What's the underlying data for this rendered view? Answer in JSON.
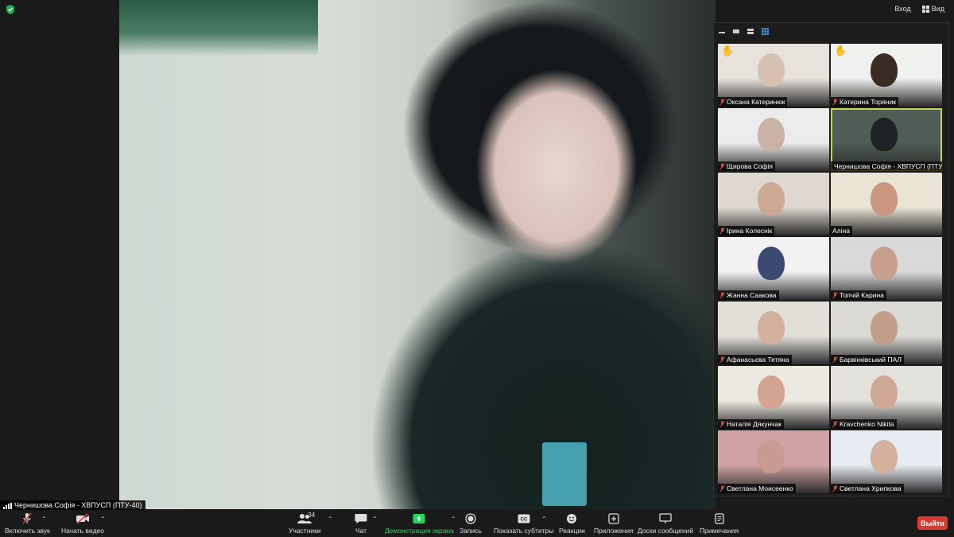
{
  "header": {
    "signin_label": "Вход",
    "view_label": "Вид"
  },
  "speaker": {
    "name": "Чернишова Софія - ХВПУСП (ПТУ-40)"
  },
  "gallery": {
    "participants": [
      {
        "name": "Оксана Катеринюк",
        "muted": true,
        "hand_raised": true,
        "active": false
      },
      {
        "name": "Катерина Торяник",
        "muted": true,
        "hand_raised": true,
        "active": false
      },
      {
        "name": "Щирова Софія",
        "muted": true,
        "hand_raised": false,
        "active": false
      },
      {
        "name": "Чернишова Софія - ХВПУСП (ПТУ-...",
        "muted": true,
        "hand_raised": false,
        "active": true
      },
      {
        "name": "Ірина Колеснік",
        "muted": true,
        "hand_raised": false,
        "active": false
      },
      {
        "name": "Аліна",
        "muted": false,
        "hand_raised": false,
        "active": false
      },
      {
        "name": "Жанна Саакова",
        "muted": true,
        "hand_raised": false,
        "active": false
      },
      {
        "name": "Топчій Карина",
        "muted": true,
        "hand_raised": false,
        "active": false
      },
      {
        "name": "Афанасьєва Тетяна",
        "muted": true,
        "hand_raised": false,
        "active": false
      },
      {
        "name": "Барвінківський ПАЛ",
        "muted": true,
        "hand_raised": false,
        "active": false
      },
      {
        "name": "Наталія Дякунчак",
        "muted": true,
        "hand_raised": false,
        "active": false
      },
      {
        "name": "Kravchenko Nikita",
        "muted": true,
        "hand_raised": false,
        "active": false
      },
      {
        "name": "Светлана Моисеенко",
        "muted": true,
        "hand_raised": false,
        "active": false
      },
      {
        "name": "Светлана Хрипкова",
        "muted": true,
        "hand_raised": false,
        "active": false
      }
    ]
  },
  "toolbar": {
    "unmute_label": "Включить звук",
    "start_video_label": "Начать видео",
    "participants_label": "Участники",
    "participants_count": "34",
    "chat_label": "Чат",
    "share_label": "Демонстрация экрана",
    "record_label": "Запись",
    "captions_label": "Показать субтитры",
    "reactions_label": "Реакции",
    "apps_label": "Приложения",
    "whiteboards_label": "Доски сообщений",
    "notes_label": "Примечания",
    "leave_label": "Выйти"
  },
  "colors": {
    "leave": "#d93b30",
    "share": "#23d959",
    "active_border": "#c9d14d",
    "secure": "#23b14d",
    "muted_icon": "#e0483d"
  }
}
